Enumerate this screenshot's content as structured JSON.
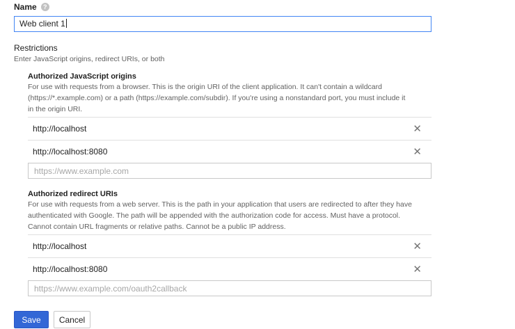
{
  "name_field": {
    "label": "Name",
    "help_icon": "?",
    "value": "Web client 1"
  },
  "restrictions": {
    "title": "Restrictions",
    "subtitle": "Enter JavaScript origins, redirect URIs, or both"
  },
  "js_origins": {
    "title": "Authorized JavaScript origins",
    "description_lines": [
      "For use with requests from a browser. This is the origin URI of the client application. It can't contain a wildcard",
      "(https://*.example.com) or a path (https://example.com/subdir). If you're using a nonstandard port, you must include it",
      "in the origin URI."
    ],
    "items": [
      {
        "uri": "http://localhost"
      },
      {
        "uri": "http://localhost:8080"
      }
    ],
    "placeholder": "https://www.example.com"
  },
  "redirect_uris": {
    "title": "Authorized redirect URIs",
    "description_lines": [
      "For use with requests from a web server. This is the path in your application that users are redirected to after they have",
      "authenticated with Google. The path will be appended with the authorization code for access. Must have a protocol.",
      "Cannot contain URL fragments or relative paths. Cannot be a public IP address."
    ],
    "items": [
      {
        "uri": "http://localhost"
      },
      {
        "uri": "http://localhost:8080"
      }
    ],
    "placeholder": "https://www.example.com/oauth2callback"
  },
  "remove_icon": "close-icon",
  "remove_glyph": "✕",
  "buttons": {
    "save": "Save",
    "cancel": "Cancel"
  },
  "colors": {
    "primary": "#3367d6",
    "focus_border": "#4285f4"
  }
}
